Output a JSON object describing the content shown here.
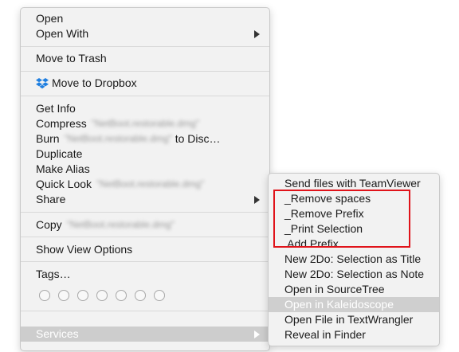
{
  "main_menu": {
    "open": "Open",
    "open_with": "Open With",
    "move_to_trash": "Move to Trash",
    "move_to_dropbox": "Move to Dropbox",
    "get_info": "Get Info",
    "compress": "Compress",
    "compress_file": "\"NetBoot.restorable.dmg\"",
    "burn": "Burn",
    "burn_file": "\"NetBoot.restorable.dmg\"",
    "burn_suffix": "to Disc…",
    "duplicate": "Duplicate",
    "make_alias": "Make Alias",
    "quick_look": "Quick Look",
    "quick_look_file": "\"NetBoot.restorable.dmg\"",
    "share": "Share",
    "copy": "Copy",
    "copy_file": "\"NetBoot.restorable.dmg\"",
    "show_view_options": "Show View Options",
    "tags": "Tags…",
    "services": "Services"
  },
  "services_menu": {
    "items": [
      "Send files with TeamViewer",
      "_Remove spaces",
      "_Remove Prefix",
      "_Print Selection",
      " Add Prefix",
      "New 2Do: Selection as Title",
      "New 2Do: Selection as Note",
      "Open in SourceTree",
      "Open in Kaleidoscope",
      "Open File in TextWrangler",
      "Reveal in Finder"
    ],
    "highlighted": "Open in Kaleidoscope"
  },
  "colors": {
    "highlight": "#cdcdcd",
    "annotation_box": "#e0131a",
    "dropbox_blue": "#1f7fe0"
  },
  "icons": {
    "dropbox": "dropbox-icon",
    "submenu_arrow": "chevron-right-icon",
    "tag": "tag-circle-icon"
  }
}
